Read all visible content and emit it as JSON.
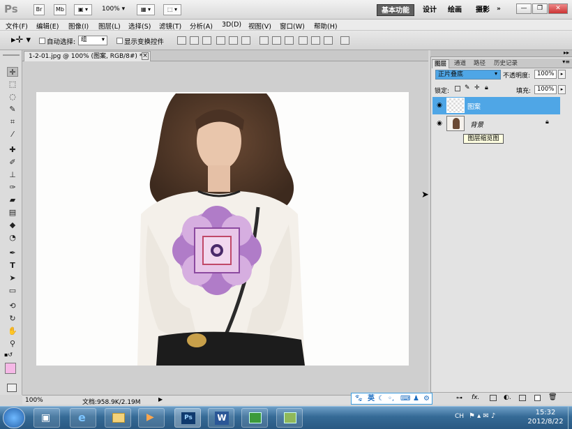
{
  "app": {
    "logo": "Ps",
    "bridge": "Br",
    "minibridge": "Mb",
    "zoom": "100%",
    "workspaces": [
      "基本功能",
      "设计",
      "绘画",
      "摄影"
    ]
  },
  "window_controls": {
    "minimize": "—",
    "restore": "❐",
    "close": "✕"
  },
  "menu": [
    "文件(F)",
    "编辑(E)",
    "图像(I)",
    "图层(L)",
    "选择(S)",
    "滤镜(T)",
    "分析(A)",
    "3D(D)",
    "视图(V)",
    "窗口(W)",
    "帮助(H)"
  ],
  "options": {
    "auto_select_label": "自动选择:",
    "auto_select_value": "组",
    "transform_controls_label": "显示变换控件"
  },
  "document": {
    "tab_title": "1-2-01.jpg @ 100% (图案, RGB/8#) *",
    "tab_close": "×"
  },
  "status": {
    "zoom": "100%",
    "doc_size": "文档:958.9K/2.19M"
  },
  "panel": {
    "tabs": [
      "图层",
      "通道",
      "路径",
      "历史记录"
    ],
    "blend_mode": "正片叠底",
    "opacity_label": "不透明度:",
    "opacity_value": "100%",
    "lock_label": "锁定:",
    "fill_label": "填充:",
    "fill_value": "100%",
    "layers": [
      {
        "name": "图案",
        "selected": true
      },
      {
        "name": "背景",
        "selected": false,
        "locked": true
      }
    ],
    "tooltip": "图层缩览图",
    "bottom_icons": [
      "link-icon",
      "fx-icon",
      "mask-icon",
      "adjustment-icon",
      "folder-icon",
      "new-layer-icon",
      "trash-icon"
    ]
  },
  "ime": {
    "label": "英"
  },
  "clock": {
    "time": "15:32",
    "date": "2012/8/22"
  },
  "colors": {
    "accent": "#4fa6e6",
    "swatch_fg": "#f5b8e6",
    "taskbar": "#2f6390"
  }
}
